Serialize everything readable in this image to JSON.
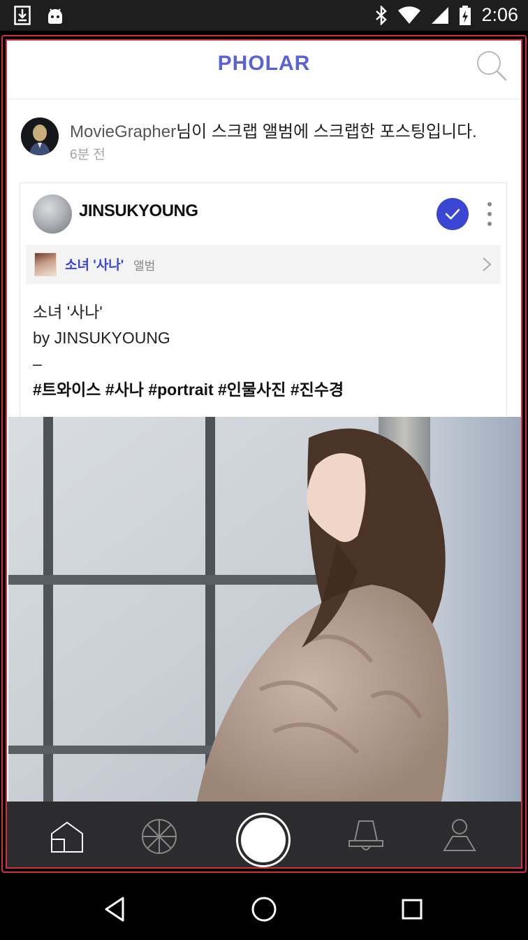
{
  "status_bar": {
    "time": "2:06",
    "icons": [
      "download-icon",
      "android-icon",
      "bluetooth-icon",
      "wifi-icon",
      "signal-icon",
      "battery-icon"
    ]
  },
  "app": {
    "logo": "PHOLAR",
    "accent_color": "#3b46d2",
    "brand_color": "#5a62d6"
  },
  "notice": {
    "user": "MovieGrapher",
    "message": "님이 스크랩 앨범에 스크랩한 포스팅입니다.",
    "time": "6분 전"
  },
  "post": {
    "author": "JINSUKYOUNG",
    "following": true,
    "album": {
      "title": "소녀 '사나'",
      "suffix": "앨범"
    },
    "caption_lines": [
      "소녀 '사나'",
      "by JINSUKYOUNG",
      "–"
    ],
    "tags": "#트와이스 #사나 #portrait #인물사진 #진수경",
    "image_description_icon": "photo"
  },
  "bottom_nav": {
    "items": [
      "home-icon",
      "explore-icon",
      "camera-capture-button",
      "notifications-bell-icon",
      "profile-icon"
    ]
  },
  "system_nav": [
    "back-icon",
    "home-circle-icon",
    "recents-square-icon"
  ]
}
